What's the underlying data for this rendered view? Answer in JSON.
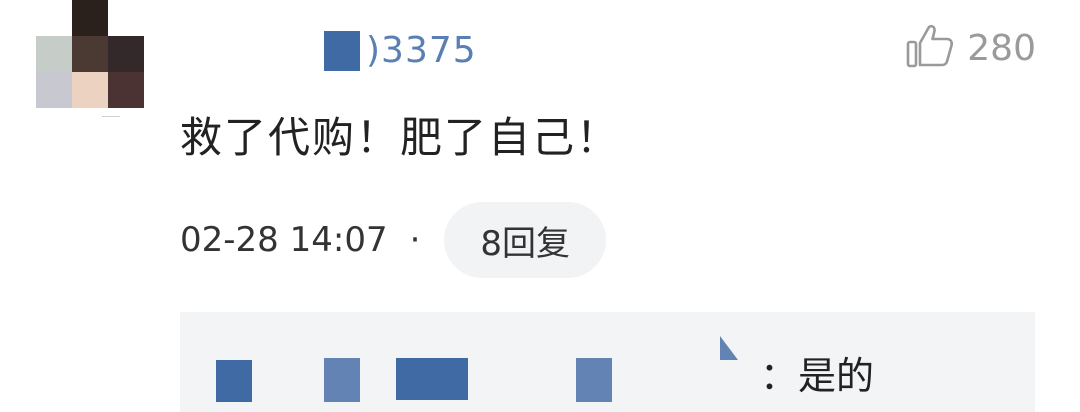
{
  "comment": {
    "username_suffix": ")3375",
    "content": "救了代购！肥了自己！",
    "timestamp": "02-28 14:07",
    "separator": "·",
    "reply_button_label": "8回复",
    "like_count": "280"
  },
  "reply_preview": {
    "text": "：是的"
  },
  "colors": {
    "link_blue": "#5a7fb3",
    "mask_blue": "#3f6aa3",
    "panel_bg": "#f3f4f6",
    "muted": "#9a9a9a"
  },
  "icons": {
    "like": "thumbs-up-icon"
  }
}
